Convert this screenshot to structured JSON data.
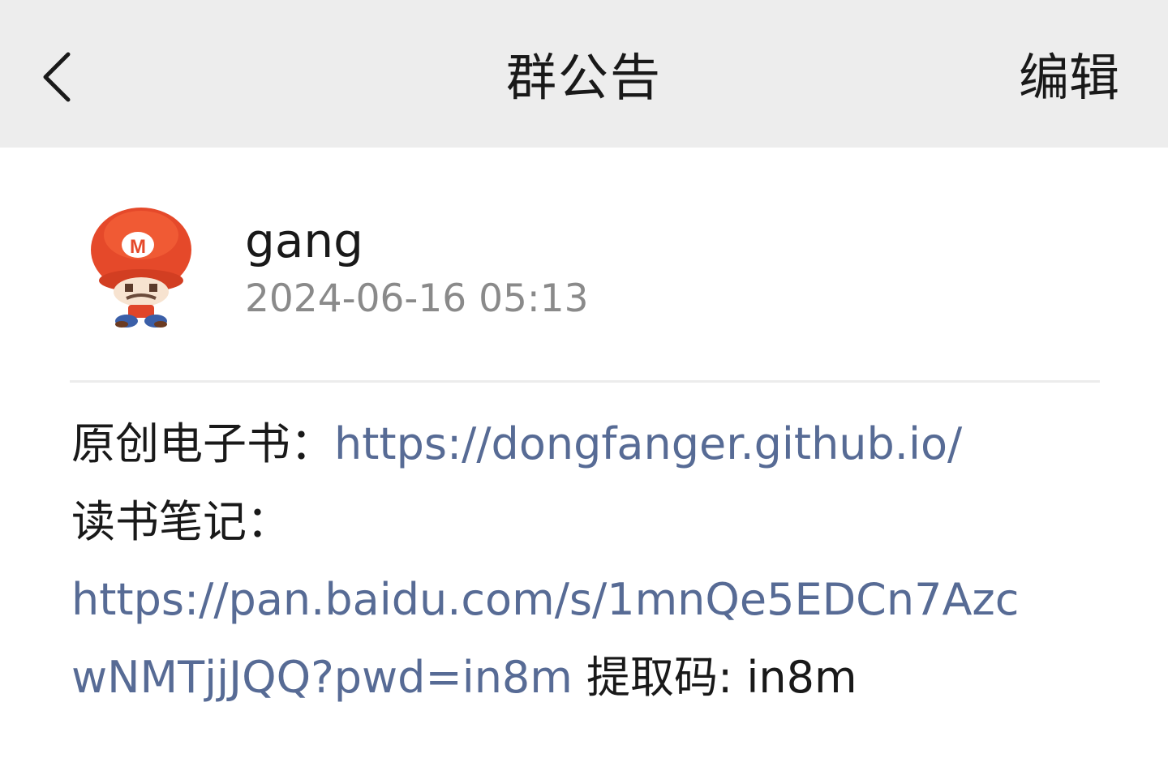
{
  "header": {
    "title": "群公告",
    "edit_label": "编辑",
    "back_icon": "chevron-left-icon"
  },
  "author": {
    "name": "gang",
    "time": "2024-06-16 05:13",
    "avatar_icon": "mario-avatar"
  },
  "notice": {
    "ebook_label": "原创电子书：",
    "ebook_link": "https://dongfanger.github.io/",
    "notes_label": "读书笔记：",
    "notes_link_part1": "https://pan.baidu.com/s/1mnQe5EDCn7Azc",
    "notes_link_part2": "wNMTjjJQQ?pwd=in8m",
    "code_label": " 提取码: in8m"
  },
  "colors": {
    "header_bg": "#ededed",
    "link": "#576b95",
    "text": "#191919",
    "secondary_text": "#8a8a8a"
  }
}
